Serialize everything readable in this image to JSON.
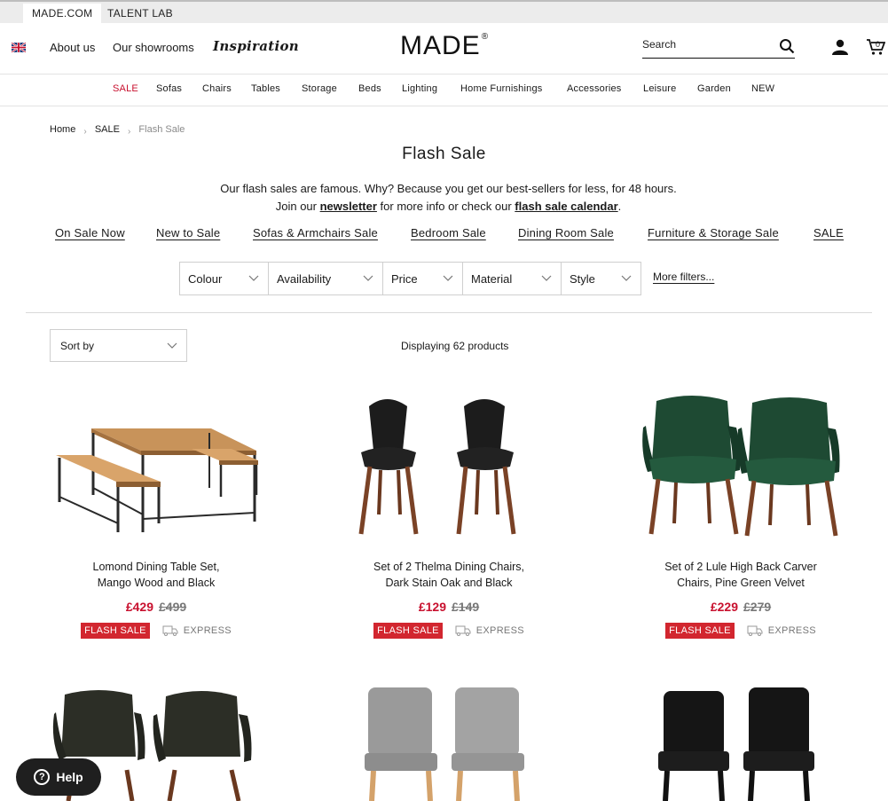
{
  "topstrip": {
    "tabs": [
      "MADE.COM",
      "TALENT LAB"
    ]
  },
  "header": {
    "about": "About us",
    "showrooms": "Our showrooms",
    "inspiration": "Inspiration",
    "logo": "MADE",
    "logo_mark": "®",
    "search_placeholder": "Search",
    "cart_count": "0"
  },
  "nav": {
    "items": [
      "SALE",
      "Sofas",
      "Chairs",
      "Tables",
      "Storage",
      "Beds",
      "Lighting",
      "Home Furnishings",
      "Accessories",
      "Leisure",
      "Garden",
      "NEW"
    ],
    "highlight_color": "#c8102e"
  },
  "breadcrumb": [
    "Home",
    "SALE",
    "Flash Sale"
  ],
  "page": {
    "title": "Flash Sale",
    "intro_line1": "Our flash sales are famous. Why? Because you get our best-sellers for less, for 48 hours.",
    "intro_join": "Join our",
    "intro_newsletter": "newsletter",
    "intro_mid": "for more info or check our",
    "intro_calendar": "flash sale calendar",
    "intro_end": "."
  },
  "categories": [
    "On Sale Now",
    "New to Sale",
    "Sofas & Armchairs Sale",
    "Bedroom Sale",
    "Dining Room Sale",
    "Furniture & Storage Sale",
    "SALE"
  ],
  "filters": {
    "items": [
      "Colour",
      "Availability",
      "Price",
      "Material",
      "Style"
    ],
    "more": "More filters..."
  },
  "sort": {
    "label": "Sort by"
  },
  "results": {
    "count_text": "Displaying 62 products"
  },
  "products": [
    {
      "name_line1": "Lomond Dining Table Set,",
      "name_line2": "Mango Wood and Black",
      "price": "£429",
      "was": "£499",
      "badge": "FLASH SALE",
      "delivery": "EXPRESS"
    },
    {
      "name_line1": "Set of 2 Thelma Dining Chairs,",
      "name_line2": "Dark Stain Oak and Black",
      "price": "£129",
      "was": "£149",
      "badge": "FLASH SALE",
      "delivery": "EXPRESS"
    },
    {
      "name_line1": "Set of 2 Lule High Back Carver",
      "name_line2": "Chairs, Pine Green Velvet",
      "price": "£229",
      "was": "£279",
      "badge": "FLASH SALE",
      "delivery": "EXPRESS"
    }
  ],
  "help": {
    "label": "Help"
  },
  "colors": {
    "sale_red": "#c8102e",
    "badge_red": "#d2262f"
  }
}
